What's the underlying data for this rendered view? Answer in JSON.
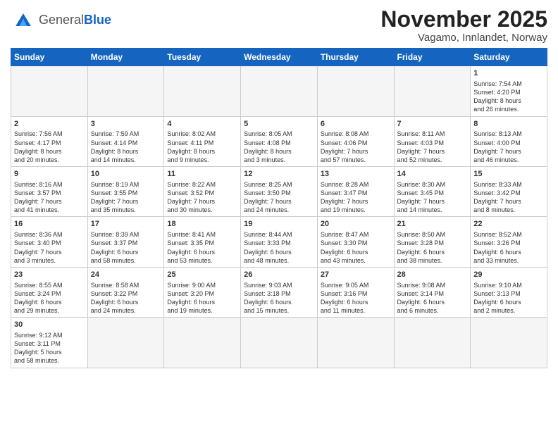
{
  "header": {
    "logo_general": "General",
    "logo_blue": "Blue",
    "month_title": "November 2025",
    "subtitle": "Vagamo, Innlandet, Norway"
  },
  "weekdays": [
    "Sunday",
    "Monday",
    "Tuesday",
    "Wednesday",
    "Thursday",
    "Friday",
    "Saturday"
  ],
  "weeks": [
    [
      {
        "day": "",
        "info": ""
      },
      {
        "day": "",
        "info": ""
      },
      {
        "day": "",
        "info": ""
      },
      {
        "day": "",
        "info": ""
      },
      {
        "day": "",
        "info": ""
      },
      {
        "day": "",
        "info": ""
      },
      {
        "day": "1",
        "info": "Sunrise: 7:54 AM\nSunset: 4:20 PM\nDaylight: 8 hours\nand 26 minutes."
      }
    ],
    [
      {
        "day": "2",
        "info": "Sunrise: 7:56 AM\nSunset: 4:17 PM\nDaylight: 8 hours\nand 20 minutes."
      },
      {
        "day": "3",
        "info": "Sunrise: 7:59 AM\nSunset: 4:14 PM\nDaylight: 8 hours\nand 14 minutes."
      },
      {
        "day": "4",
        "info": "Sunrise: 8:02 AM\nSunset: 4:11 PM\nDaylight: 8 hours\nand 9 minutes."
      },
      {
        "day": "5",
        "info": "Sunrise: 8:05 AM\nSunset: 4:08 PM\nDaylight: 8 hours\nand 3 minutes."
      },
      {
        "day": "6",
        "info": "Sunrise: 8:08 AM\nSunset: 4:06 PM\nDaylight: 7 hours\nand 57 minutes."
      },
      {
        "day": "7",
        "info": "Sunrise: 8:11 AM\nSunset: 4:03 PM\nDaylight: 7 hours\nand 52 minutes."
      },
      {
        "day": "8",
        "info": "Sunrise: 8:13 AM\nSunset: 4:00 PM\nDaylight: 7 hours\nand 46 minutes."
      }
    ],
    [
      {
        "day": "9",
        "info": "Sunrise: 8:16 AM\nSunset: 3:57 PM\nDaylight: 7 hours\nand 41 minutes."
      },
      {
        "day": "10",
        "info": "Sunrise: 8:19 AM\nSunset: 3:55 PM\nDaylight: 7 hours\nand 35 minutes."
      },
      {
        "day": "11",
        "info": "Sunrise: 8:22 AM\nSunset: 3:52 PM\nDaylight: 7 hours\nand 30 minutes."
      },
      {
        "day": "12",
        "info": "Sunrise: 8:25 AM\nSunset: 3:50 PM\nDaylight: 7 hours\nand 24 minutes."
      },
      {
        "day": "13",
        "info": "Sunrise: 8:28 AM\nSunset: 3:47 PM\nDaylight: 7 hours\nand 19 minutes."
      },
      {
        "day": "14",
        "info": "Sunrise: 8:30 AM\nSunset: 3:45 PM\nDaylight: 7 hours\nand 14 minutes."
      },
      {
        "day": "15",
        "info": "Sunrise: 8:33 AM\nSunset: 3:42 PM\nDaylight: 7 hours\nand 8 minutes."
      }
    ],
    [
      {
        "day": "16",
        "info": "Sunrise: 8:36 AM\nSunset: 3:40 PM\nDaylight: 7 hours\nand 3 minutes."
      },
      {
        "day": "17",
        "info": "Sunrise: 8:39 AM\nSunset: 3:37 PM\nDaylight: 6 hours\nand 58 minutes."
      },
      {
        "day": "18",
        "info": "Sunrise: 8:41 AM\nSunset: 3:35 PM\nDaylight: 6 hours\nand 53 minutes."
      },
      {
        "day": "19",
        "info": "Sunrise: 8:44 AM\nSunset: 3:33 PM\nDaylight: 6 hours\nand 48 minutes."
      },
      {
        "day": "20",
        "info": "Sunrise: 8:47 AM\nSunset: 3:30 PM\nDaylight: 6 hours\nand 43 minutes."
      },
      {
        "day": "21",
        "info": "Sunrise: 8:50 AM\nSunset: 3:28 PM\nDaylight: 6 hours\nand 38 minutes."
      },
      {
        "day": "22",
        "info": "Sunrise: 8:52 AM\nSunset: 3:26 PM\nDaylight: 6 hours\nand 33 minutes."
      }
    ],
    [
      {
        "day": "23",
        "info": "Sunrise: 8:55 AM\nSunset: 3:24 PM\nDaylight: 6 hours\nand 29 minutes."
      },
      {
        "day": "24",
        "info": "Sunrise: 8:58 AM\nSunset: 3:22 PM\nDaylight: 6 hours\nand 24 minutes."
      },
      {
        "day": "25",
        "info": "Sunrise: 9:00 AM\nSunset: 3:20 PM\nDaylight: 6 hours\nand 19 minutes."
      },
      {
        "day": "26",
        "info": "Sunrise: 9:03 AM\nSunset: 3:18 PM\nDaylight: 6 hours\nand 15 minutes."
      },
      {
        "day": "27",
        "info": "Sunrise: 9:05 AM\nSunset: 3:16 PM\nDaylight: 6 hours\nand 11 minutes."
      },
      {
        "day": "28",
        "info": "Sunrise: 9:08 AM\nSunset: 3:14 PM\nDaylight: 6 hours\nand 6 minutes."
      },
      {
        "day": "29",
        "info": "Sunrise: 9:10 AM\nSunset: 3:13 PM\nDaylight: 6 hours\nand 2 minutes."
      }
    ],
    [
      {
        "day": "30",
        "info": "Sunrise: 9:12 AM\nSunset: 3:11 PM\nDaylight: 5 hours\nand 58 minutes."
      },
      {
        "day": "",
        "info": ""
      },
      {
        "day": "",
        "info": ""
      },
      {
        "day": "",
        "info": ""
      },
      {
        "day": "",
        "info": ""
      },
      {
        "day": "",
        "info": ""
      },
      {
        "day": "",
        "info": ""
      }
    ]
  ]
}
